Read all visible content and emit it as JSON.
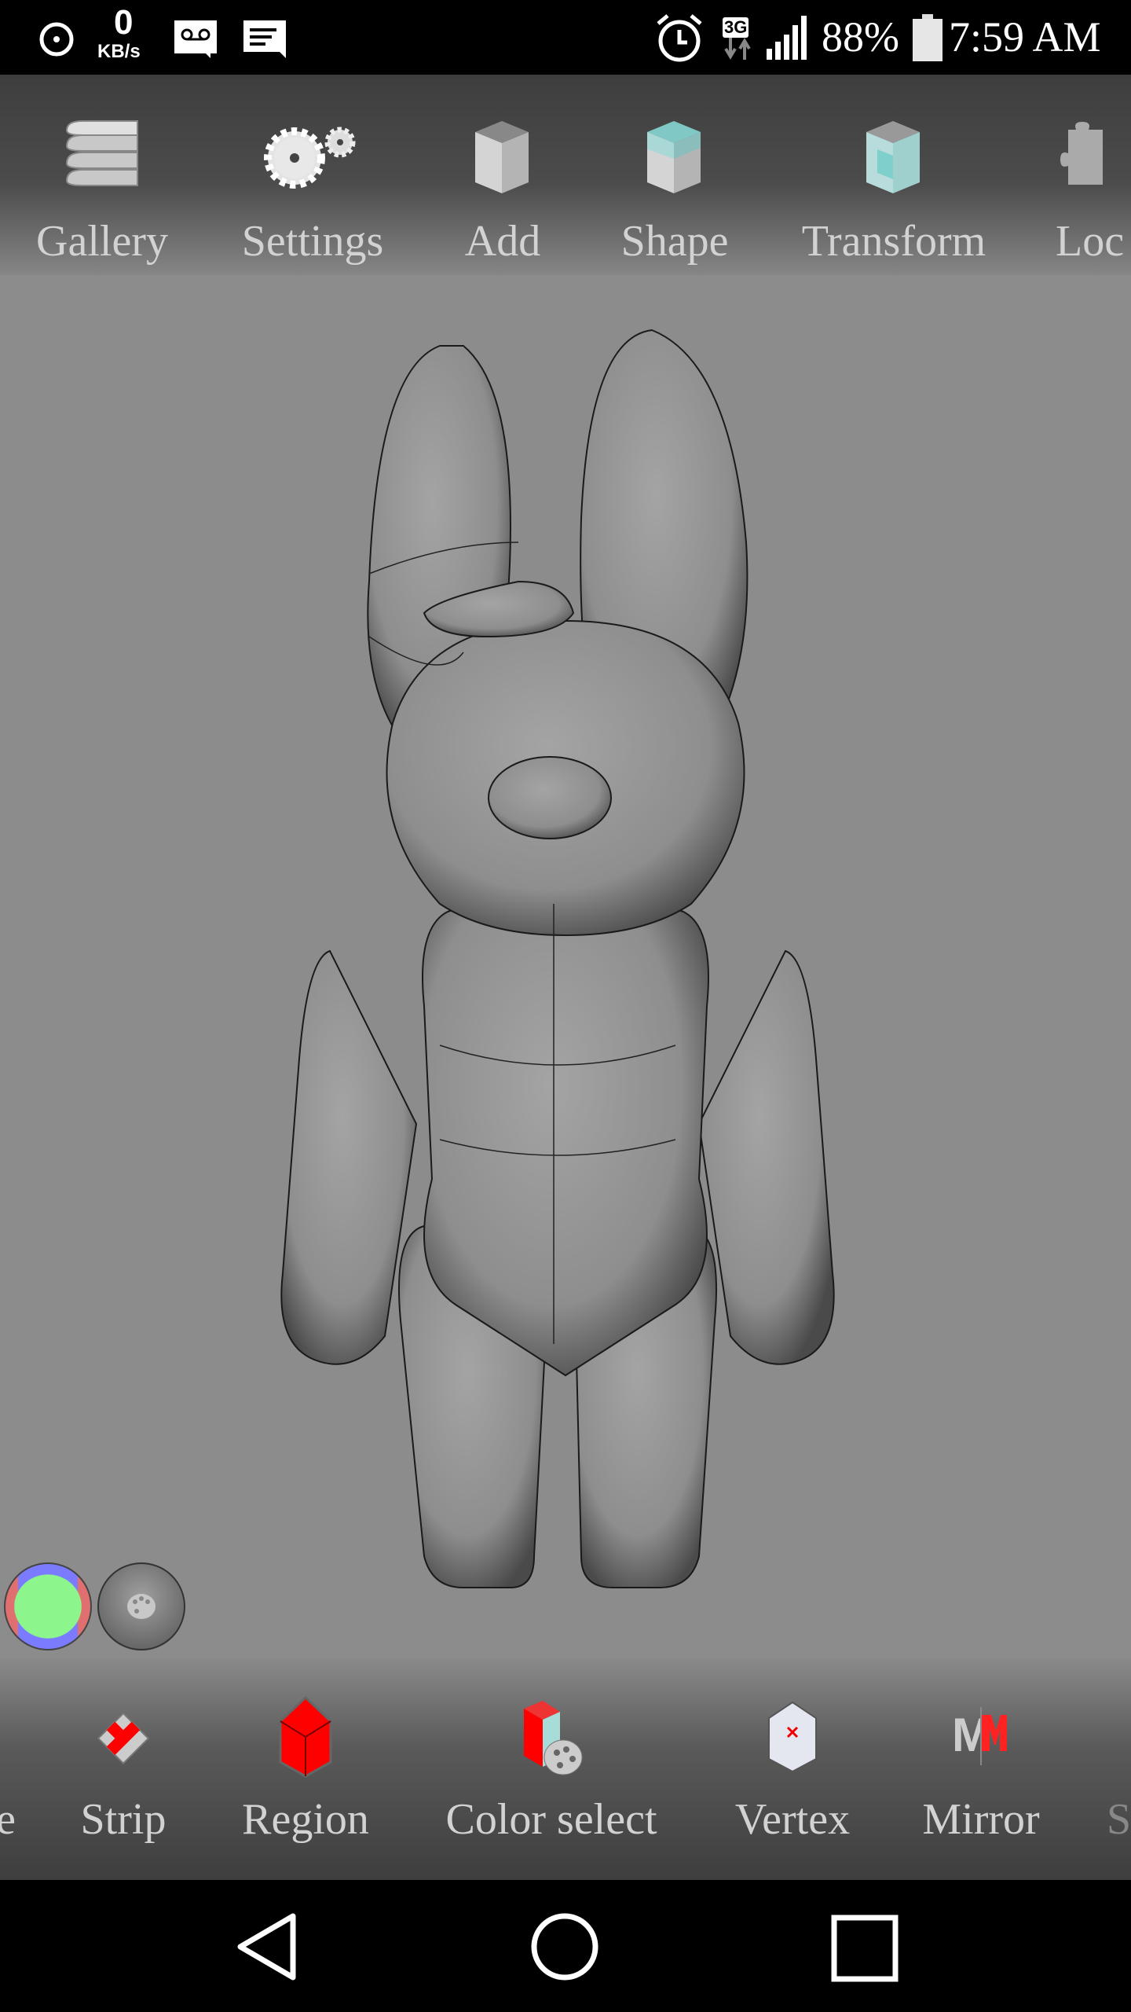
{
  "status_bar": {
    "net_speed_value": "0",
    "net_speed_unit": "KB/s",
    "network_type": "3G",
    "battery": "88%",
    "time": "7:59 AM",
    "icons": [
      "alarm-icon",
      "voicemail-icon",
      "message-icon",
      "alarm-clock-icon",
      "signal-icon",
      "battery-icon"
    ]
  },
  "top_toolbar": {
    "items": [
      {
        "label": "Gallery",
        "icon": "stack-icon"
      },
      {
        "label": "Settings",
        "icon": "gears-icon"
      },
      {
        "label": "Add",
        "icon": "cube-icon"
      },
      {
        "label": "Shape",
        "icon": "glass-cube-icon"
      },
      {
        "label": "Transform",
        "icon": "transform-cube-icon"
      },
      {
        "label": "Loc",
        "icon": "puzzle-icon"
      }
    ]
  },
  "viewport": {
    "color_button_colors": {
      "center": "#8cf58c",
      "top_bottom": "#7b7bff",
      "sides": "#e07070"
    }
  },
  "bottom_toolbar": {
    "items": [
      {
        "label": "e",
        "icon": "none"
      },
      {
        "label": "Strip",
        "icon": "strip-icon"
      },
      {
        "label": "Region",
        "icon": "region-cube-icon"
      },
      {
        "label": "Color select",
        "icon": "color-select-icon"
      },
      {
        "label": "Vertex",
        "icon": "vertex-icon"
      },
      {
        "label": "Mirror",
        "icon": "mirror-icon"
      },
      {
        "label": "S",
        "icon": "none"
      }
    ]
  },
  "nav_bar": {
    "icons": [
      "back-icon",
      "home-icon",
      "recents-icon"
    ]
  }
}
